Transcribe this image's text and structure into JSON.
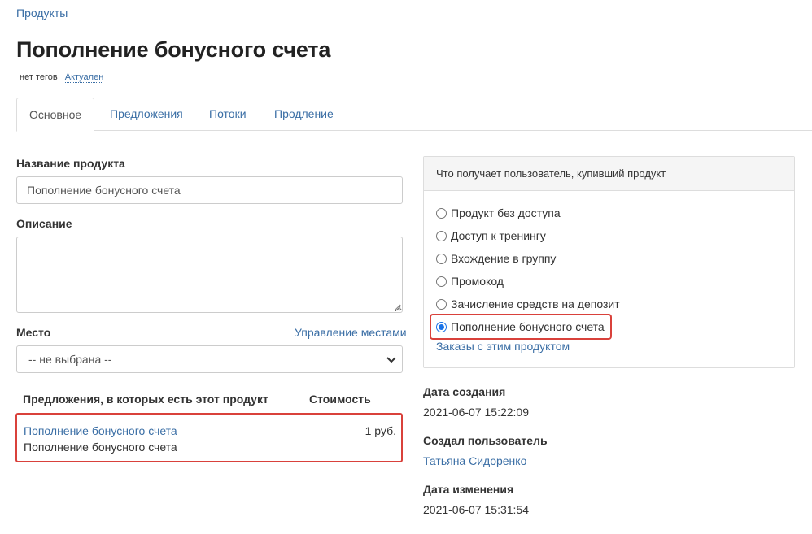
{
  "breadcrumb": "Продукты",
  "title": "Пополнение бонусного счета",
  "tags": {
    "no_tags": "нет тегов",
    "status": "Актуален"
  },
  "tabs": [
    {
      "label": "Основное",
      "active": true
    },
    {
      "label": "Предложения",
      "active": false
    },
    {
      "label": "Потоки",
      "active": false
    },
    {
      "label": "Продление",
      "active": false
    }
  ],
  "form": {
    "name_label": "Название продукта",
    "name_value": "Пополнение бонусного счета",
    "description_label": "Описание",
    "description_value": "",
    "place_label": "Место",
    "manage_places_link": "Управление местами",
    "place_select_value": "-- не выбрана --"
  },
  "offers": {
    "col_name": "Предложения, в которых есть этот продукт",
    "col_price": "Стоимость",
    "rows": [
      {
        "link": "Пополнение бонусного счета",
        "desc": "Пополнение бонусного счета",
        "price": "1 руб."
      }
    ]
  },
  "access_panel": {
    "heading": "Что получает пользователь, купивший продукт",
    "options": [
      {
        "label": "Продукт без доступа",
        "checked": false
      },
      {
        "label": "Доступ к тренингу",
        "checked": false
      },
      {
        "label": "Вхождение в группу",
        "checked": false
      },
      {
        "label": "Промокод",
        "checked": false
      },
      {
        "label": "Зачисление средств на депозит",
        "checked": false
      },
      {
        "label": "Пополнение бонусного счета",
        "checked": true
      }
    ],
    "orders_link": "Заказы с этим продуктом"
  },
  "meta": {
    "created_label": "Дата создания",
    "created_value": "2021-06-07 15:22:09",
    "creator_label": "Создал пользователь",
    "creator_value": "Татьяна Сидоренко",
    "modified_label": "Дата изменения",
    "modified_value": "2021-06-07 15:31:54"
  },
  "colors": {
    "link": "#3a6ea5",
    "highlight": "#d9413b",
    "radio_checked": "#1a73e8"
  },
  "icons": {
    "select_chevron": "chevron-down-icon",
    "textarea_grip": "resize-grip-icon"
  }
}
